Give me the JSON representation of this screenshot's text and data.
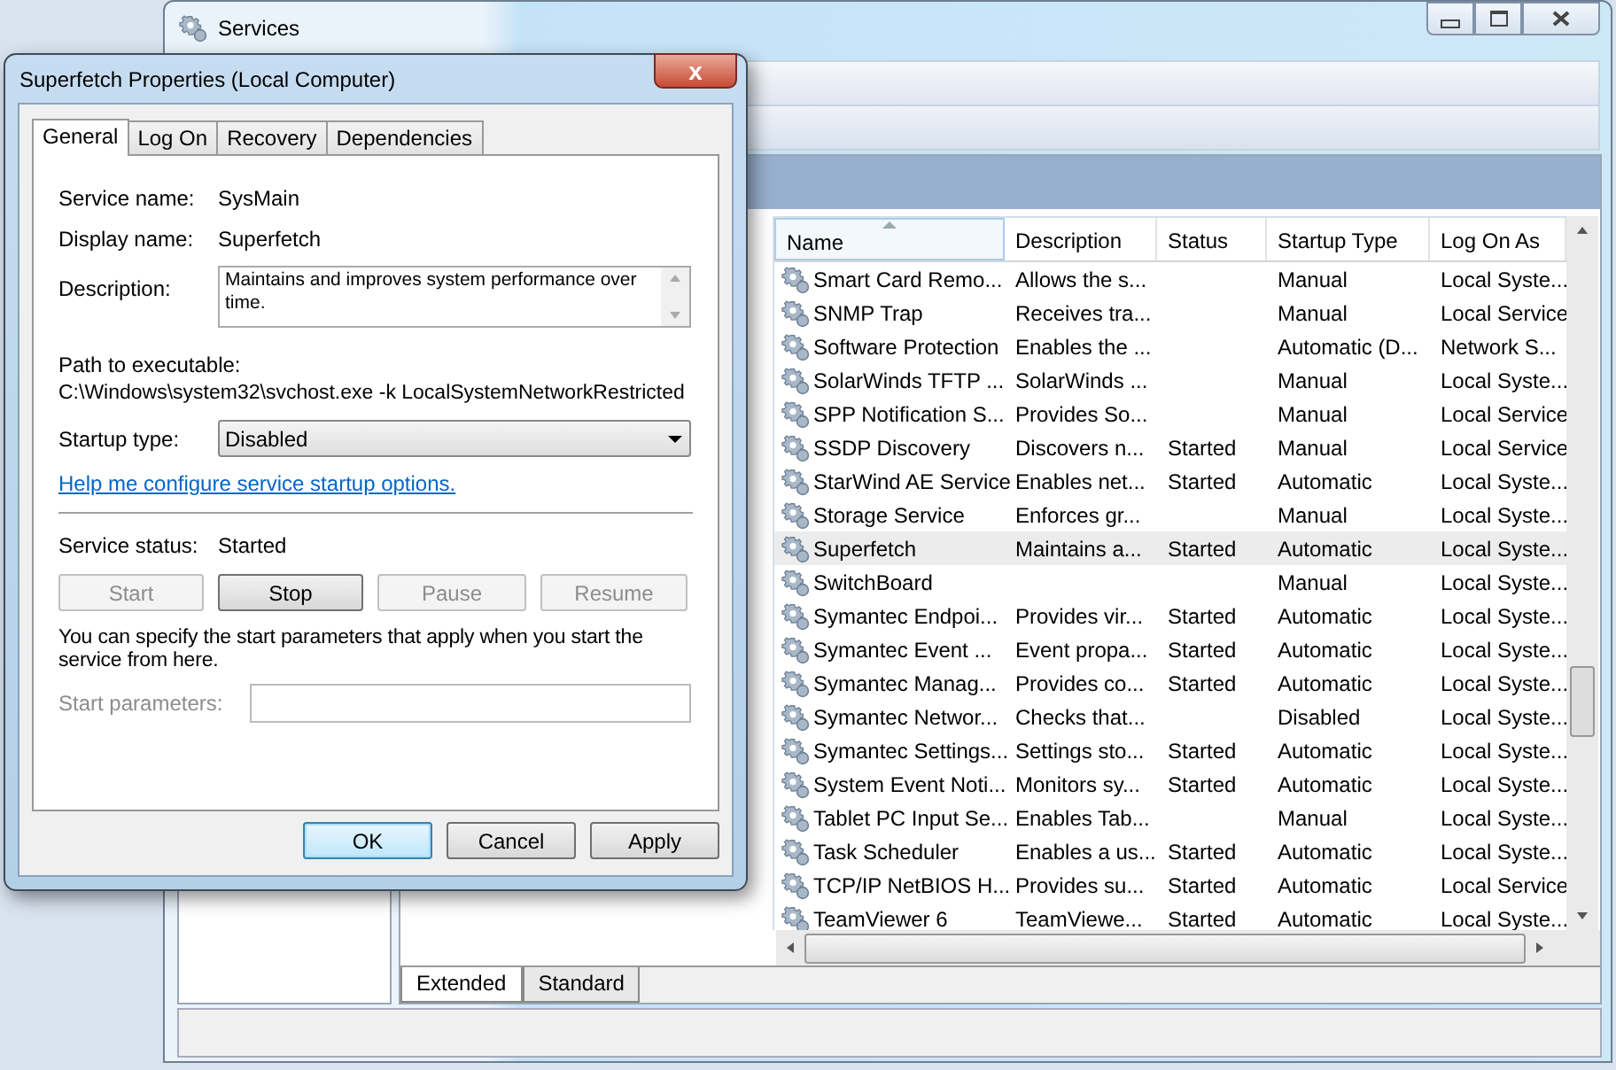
{
  "services_window": {
    "title": "Services",
    "columns": [
      {
        "label": "Name",
        "sorted": true
      },
      {
        "label": "Description",
        "sorted": false
      },
      {
        "label": "Status",
        "sorted": false
      },
      {
        "label": "Startup Type",
        "sorted": false
      },
      {
        "label": "Log On As",
        "sorted": false
      }
    ],
    "rows": [
      {
        "name": "Smart Card Remo...",
        "description": "Allows the s...",
        "status": "",
        "startup_type": "Manual",
        "log_on_as": "Local Syste...",
        "selected": false
      },
      {
        "name": "SNMP Trap",
        "description": "Receives tra...",
        "status": "",
        "startup_type": "Manual",
        "log_on_as": "Local Service",
        "selected": false
      },
      {
        "name": "Software Protection",
        "description": "Enables the ...",
        "status": "",
        "startup_type": "Automatic (D...",
        "log_on_as": "Network S...",
        "selected": false
      },
      {
        "name": "SolarWinds TFTP ...",
        "description": "SolarWinds ...",
        "status": "",
        "startup_type": "Manual",
        "log_on_as": "Local Syste...",
        "selected": false
      },
      {
        "name": "SPP Notification S...",
        "description": "Provides So...",
        "status": "",
        "startup_type": "Manual",
        "log_on_as": "Local Service",
        "selected": false
      },
      {
        "name": "SSDP Discovery",
        "description": "Discovers n...",
        "status": "Started",
        "startup_type": "Manual",
        "log_on_as": "Local Service",
        "selected": false
      },
      {
        "name": "StarWind AE Service",
        "description": "Enables net...",
        "status": "Started",
        "startup_type": "Automatic",
        "log_on_as": "Local Syste...",
        "selected": false
      },
      {
        "name": "Storage Service",
        "description": "Enforces gr...",
        "status": "",
        "startup_type": "Manual",
        "log_on_as": "Local Syste...",
        "selected": false
      },
      {
        "name": "Superfetch",
        "description": "Maintains a...",
        "status": "Started",
        "startup_type": "Automatic",
        "log_on_as": "Local Syste...",
        "selected": true
      },
      {
        "name": "SwitchBoard",
        "description": "",
        "status": "",
        "startup_type": "Manual",
        "log_on_as": "Local Syste...",
        "selected": false
      },
      {
        "name": "Symantec Endpoi...",
        "description": "Provides vir...",
        "status": "Started",
        "startup_type": "Automatic",
        "log_on_as": "Local Syste...",
        "selected": false
      },
      {
        "name": "Symantec Event ...",
        "description": "Event propa...",
        "status": "Started",
        "startup_type": "Automatic",
        "log_on_as": "Local Syste...",
        "selected": false
      },
      {
        "name": "Symantec Manag...",
        "description": "Provides co...",
        "status": "Started",
        "startup_type": "Automatic",
        "log_on_as": "Local Syste...",
        "selected": false
      },
      {
        "name": "Symantec Networ...",
        "description": "Checks that...",
        "status": "",
        "startup_type": "Disabled",
        "log_on_as": "Local Syste...",
        "selected": false
      },
      {
        "name": "Symantec Settings...",
        "description": "Settings sto...",
        "status": "Started",
        "startup_type": "Automatic",
        "log_on_as": "Local Syste...",
        "selected": false
      },
      {
        "name": "System Event Noti...",
        "description": "Monitors sy...",
        "status": "Started",
        "startup_type": "Automatic",
        "log_on_as": "Local Syste...",
        "selected": false
      },
      {
        "name": "Tablet PC Input Se...",
        "description": "Enables Tab...",
        "status": "",
        "startup_type": "Manual",
        "log_on_as": "Local Syste...",
        "selected": false
      },
      {
        "name": "Task Scheduler",
        "description": "Enables a us...",
        "status": "Started",
        "startup_type": "Automatic",
        "log_on_as": "Local Syste...",
        "selected": false
      },
      {
        "name": "TCP/IP NetBIOS H...",
        "description": "Provides su...",
        "status": "Started",
        "startup_type": "Automatic",
        "log_on_as": "Local Service",
        "selected": false
      },
      {
        "name": "TeamViewer 6",
        "description": "TeamViewe...",
        "status": "Started",
        "startup_type": "Automatic",
        "log_on_as": "Local Syste...",
        "selected": false
      }
    ],
    "view_tabs": [
      {
        "label": "Extended",
        "selected": true
      },
      {
        "label": "Standard",
        "selected": false
      }
    ]
  },
  "dialog": {
    "title": "Superfetch Properties (Local Computer)",
    "close": "x",
    "tabs": [
      {
        "label": "General",
        "selected": true
      },
      {
        "label": "Log On",
        "selected": false
      },
      {
        "label": "Recovery",
        "selected": false
      },
      {
        "label": "Dependencies",
        "selected": false
      }
    ],
    "service_name": {
      "label": "Service name:",
      "value": "SysMain"
    },
    "display_name": {
      "label": "Display name:",
      "value": "Superfetch"
    },
    "description": {
      "label": "Description:",
      "value": "Maintains and improves system performance over time."
    },
    "path": {
      "label": "Path to executable:",
      "value": "C:\\Windows\\system32\\svchost.exe -k LocalSystemNetworkRestricted"
    },
    "startup_type": {
      "label": "Startup type:",
      "value": "Disabled"
    },
    "help_link": "Help me configure service startup options.",
    "service_status": {
      "label": "Service status:",
      "value": "Started"
    },
    "control_buttons": [
      {
        "label": "Start",
        "disabled": true
      },
      {
        "label": "Stop",
        "disabled": false
      },
      {
        "label": "Pause",
        "disabled": true
      },
      {
        "label": "Resume",
        "disabled": true
      }
    ],
    "note": "You can specify the start parameters that apply when you start the service from here.",
    "start_parameters": {
      "label": "Start parameters:",
      "disabled": true
    },
    "buttons": [
      {
        "label": "OK",
        "default": true
      },
      {
        "label": "Cancel",
        "default": false
      },
      {
        "label": "Apply",
        "default": false
      }
    ]
  }
}
